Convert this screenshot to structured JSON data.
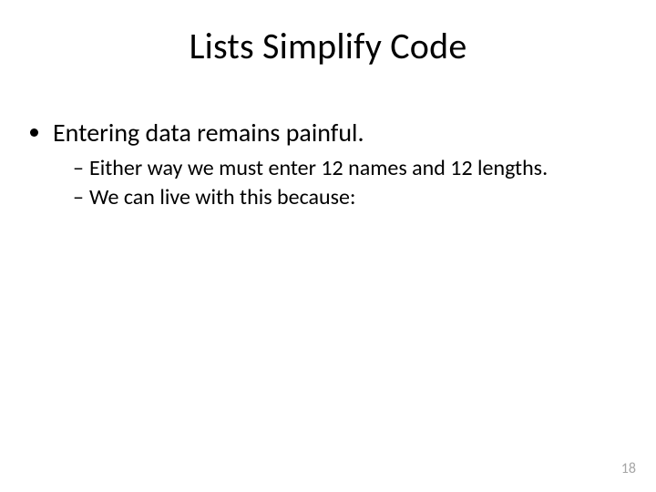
{
  "slide": {
    "title": "Lists Simplify Code",
    "bullets": {
      "level1": [
        {
          "text": "Entering data remains painful.",
          "children": [
            "Either way we must enter 12 names and 12 lengths.",
            "We can live with this because:"
          ]
        }
      ]
    },
    "page_number": "18"
  }
}
